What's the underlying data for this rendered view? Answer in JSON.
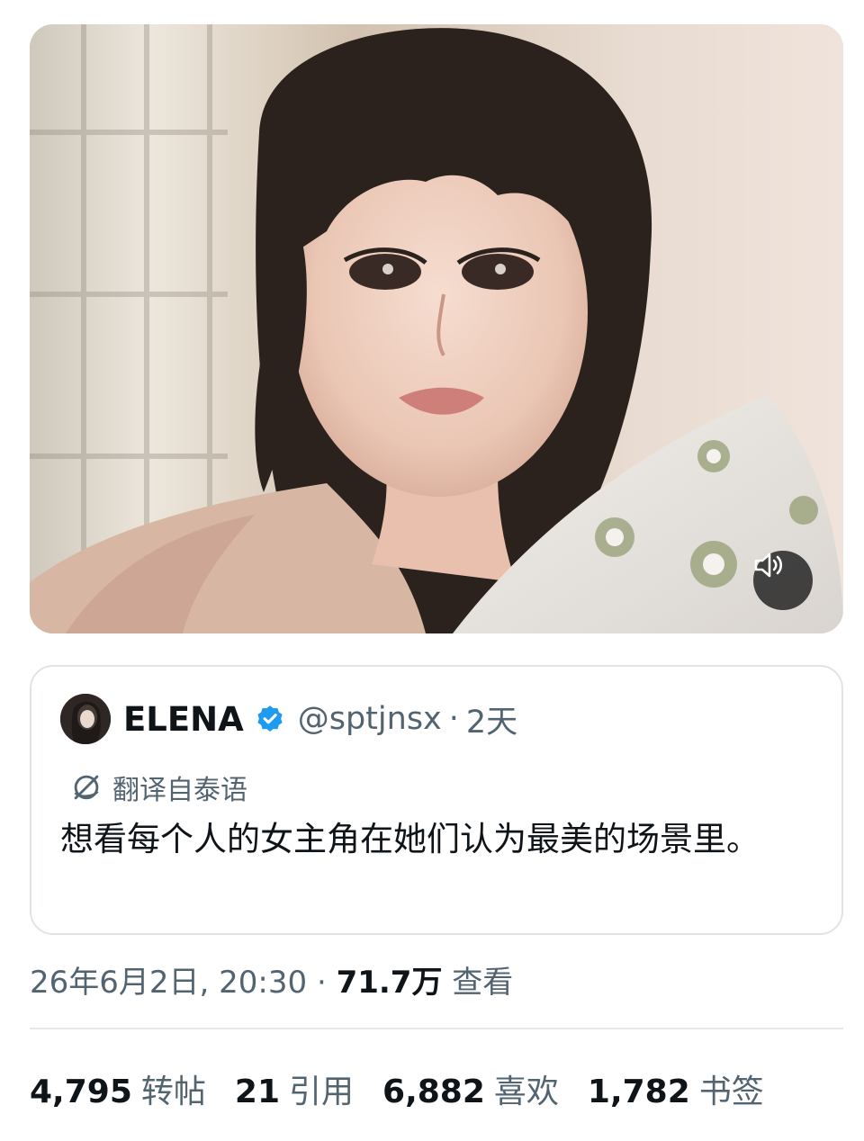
{
  "quoted": {
    "name": "ELENA",
    "handle": "@sptjnsx",
    "separator": "·",
    "time": "2天",
    "translated_label": "翻译自泰语",
    "text": "想看每个人的女主角在她们认为最美的场景里。"
  },
  "meta": {
    "datetime": "26年6月2日, 20:30",
    "separator": "·",
    "views": "71.7万",
    "views_label": "查看"
  },
  "stats": [
    {
      "value": "4,795",
      "label": "转帖"
    },
    {
      "value": "21",
      "label": "引用"
    },
    {
      "value": "6,882",
      "label": "喜欢"
    },
    {
      "value": "1,782",
      "label": "书签"
    }
  ],
  "icons": {
    "sound": "speaker-icon",
    "verified": "verified-badge-icon",
    "translate": "globe-icon"
  },
  "colors": {
    "verified": "#1d9bf0",
    "secondary_text": "#536471"
  }
}
